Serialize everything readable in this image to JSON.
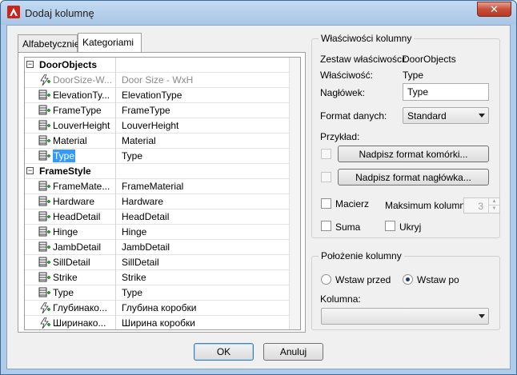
{
  "window": {
    "title": "Dodaj kolumnę",
    "close_label": "✕"
  },
  "tabs": [
    {
      "label": "Alfabetycznie",
      "active": false
    },
    {
      "label": "Kategoriami",
      "active": true
    }
  ],
  "grid": {
    "rows": [
      {
        "type": "category",
        "name": "DoorObjects",
        "value": ""
      },
      {
        "type": "property",
        "icon": "lightning-icon",
        "name": "DoorSize-W...",
        "value": "Door Size - WxH",
        "dim": true
      },
      {
        "type": "property",
        "icon": "table-add-icon",
        "name": "ElevationTy...",
        "value": "ElevationType"
      },
      {
        "type": "property",
        "icon": "table-add-icon",
        "name": "FrameType",
        "value": "FrameType"
      },
      {
        "type": "property",
        "icon": "table-add-icon",
        "name": "LouverHeight",
        "value": "LouverHeight"
      },
      {
        "type": "property",
        "icon": "table-add-icon",
        "name": "Material",
        "value": "Material"
      },
      {
        "type": "property",
        "icon": "table-add-icon",
        "name": "Type",
        "value": "Type",
        "selected": true
      },
      {
        "type": "category",
        "name": "FrameStyle",
        "value": ""
      },
      {
        "type": "property",
        "icon": "table-add-icon",
        "name": "FrameMate...",
        "value": "FrameMaterial"
      },
      {
        "type": "property",
        "icon": "table-add-icon",
        "name": "Hardware",
        "value": "Hardware"
      },
      {
        "type": "property",
        "icon": "table-add-icon",
        "name": "HeadDetail",
        "value": "HeadDetail"
      },
      {
        "type": "property",
        "icon": "table-add-icon",
        "name": "Hinge",
        "value": "Hinge"
      },
      {
        "type": "property",
        "icon": "table-add-icon",
        "name": "JambDetail",
        "value": "JambDetail"
      },
      {
        "type": "property",
        "icon": "table-add-icon",
        "name": "SillDetail",
        "value": "SillDetail"
      },
      {
        "type": "property",
        "icon": "table-add-icon",
        "name": "Strike",
        "value": "Strike"
      },
      {
        "type": "property",
        "icon": "table-add-icon",
        "name": "Type",
        "value": "Type"
      },
      {
        "type": "property",
        "icon": "lightning-icon",
        "name": "Глубинако...",
        "value": "Глубина коробки"
      },
      {
        "type": "property",
        "icon": "lightning-icon",
        "name": "Ширинако...",
        "value": "Ширина коробки"
      }
    ]
  },
  "column_props": {
    "group_title": "Właściwości kolumny",
    "set_label": "Zestaw właściwości:",
    "set_value": "DoorObjects",
    "prop_label": "Właściwość:",
    "prop_value": "Type",
    "header_label": "Nagłówek:",
    "header_value": "Type",
    "format_label": "Format danych:",
    "format_value": "Standard",
    "example_label": "Przykład:",
    "override_cell_label": "Nadpisz format komórki...",
    "override_header_label": "Nadpisz format nagłówka...",
    "matrix_label": "Macierz",
    "max_columns_label": "Maksimum kolumn:",
    "max_columns_value": "3",
    "sum_label": "Suma",
    "hide_label": "Ukryj"
  },
  "column_position": {
    "group_title": "Położenie kolumny",
    "insert_before_label": "Wstaw przed",
    "insert_after_label": "Wstaw po",
    "selected": "after",
    "column_label": "Kolumna:",
    "column_value": ""
  },
  "footer": {
    "ok_label": "OK",
    "cancel_label": "Anuluj"
  }
}
